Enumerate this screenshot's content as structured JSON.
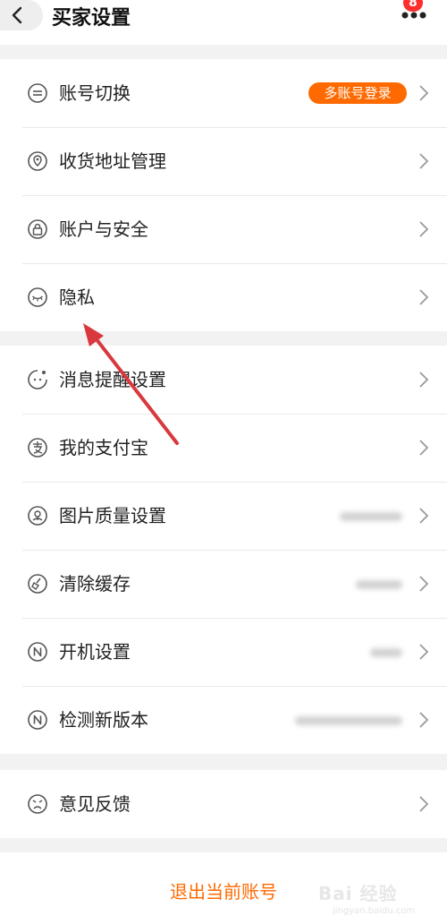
{
  "header": {
    "title": "买家设置",
    "badge_count": "8"
  },
  "group1": [
    {
      "label": "账号切换",
      "icon": "account-switch-icon",
      "tag": "多账号登录"
    },
    {
      "label": "收货地址管理",
      "icon": "location-pin-icon"
    },
    {
      "label": "账户与安全",
      "icon": "lock-icon"
    },
    {
      "label": "隐私",
      "icon": "eye-closed-icon"
    }
  ],
  "group2": [
    {
      "label": "消息提醒设置",
      "icon": "message-bell-icon"
    },
    {
      "label": "我的支付宝",
      "icon": "alipay-icon"
    },
    {
      "label": "图片质量设置",
      "icon": "image-quality-icon"
    },
    {
      "label": "清除缓存",
      "icon": "broom-icon"
    },
    {
      "label": "开机设置",
      "icon": "startup-n-icon"
    },
    {
      "label": "检测新版本",
      "icon": "version-n-icon"
    }
  ],
  "group3": [
    {
      "label": "意见反馈",
      "icon": "feedback-face-icon"
    }
  ],
  "footer": {
    "logout_label": "退出当前账号"
  },
  "watermark": {
    "brand": "Bai 经验",
    "domain": "jingyan.baidu.com"
  },
  "colors": {
    "accent": "#ff6a00",
    "badge": "#ff2d2d",
    "annotation_arrow": "#d9383e"
  }
}
